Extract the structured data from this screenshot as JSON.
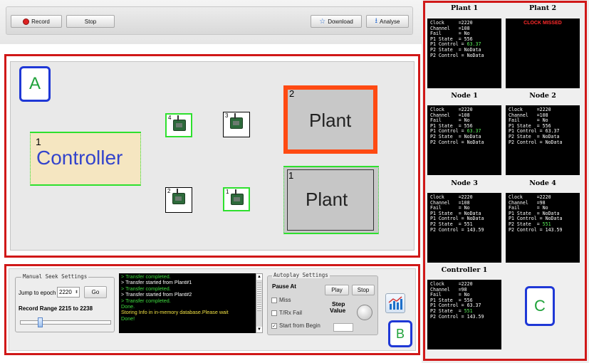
{
  "toolbar": {
    "record_label": "Record",
    "stop_label": "Stop",
    "download_label": "Download",
    "analyse_label": "Analyse"
  },
  "tags": {
    "a": "A",
    "b": "B",
    "c": "C"
  },
  "canvas": {
    "controller": {
      "id": "1",
      "label": "Controller"
    },
    "plant_top": {
      "id": "2",
      "label": "Plant"
    },
    "plant_bottom": {
      "id": "1",
      "label": "Plant"
    },
    "nodes": [
      {
        "id": "4"
      },
      {
        "id": "3"
      },
      {
        "id": "2"
      },
      {
        "id": "1"
      }
    ]
  },
  "seek": {
    "legend": "Manual Seek Settings",
    "jump_label": "Jump to epoch",
    "epoch_value": "2220",
    "go_label": "Go",
    "range_label": "Record Range 2215 to 2238"
  },
  "log": [
    {
      "text": "> Transfer completed.",
      "style": "g"
    },
    {
      "text": "> Transfer started from Plant#1",
      "style": ""
    },
    {
      "text": "> Transfer completed.",
      "style": "g"
    },
    {
      "text": "> Transfer started from Plant#2",
      "style": ""
    },
    {
      "text": "> Transfer completed.",
      "style": "g"
    },
    {
      "text": "Done.",
      "style": "g"
    },
    {
      "text": "Storing Info in in-memory database.Please wait",
      "style": "y"
    },
    {
      "text": "Done!",
      "style": "g"
    }
  ],
  "autoplay": {
    "legend": "Autoplay Settings",
    "pause_at": "Pause At",
    "play_label": "Play",
    "stop_label": "Stop",
    "miss_label": "Miss",
    "trx_label": "T/Rx Fail",
    "start_label": "Start from Begin",
    "step_value_label1": "Step",
    "step_value_label2": "Value"
  },
  "panels": {
    "plant1": {
      "title": "Plant 1"
    },
    "plant2": {
      "title": "Plant 2",
      "message": "CLOCK MISSED"
    },
    "node1": {
      "title": "Node 1"
    },
    "node2": {
      "title": "Node 2"
    },
    "node3": {
      "title": "Node 3"
    },
    "node4": {
      "title": "Node 4"
    },
    "controller1": {
      "title": "Controller 1"
    }
  },
  "terminals": {
    "plant1": [
      [
        "Clock     =2220",
        ""
      ],
      [
        "Channel   =108",
        ""
      ],
      [
        "Fail      = No",
        ""
      ],
      [
        "P1 State  = 556",
        ""
      ],
      [
        "P1 Control = ",
        "63.37"
      ],
      [
        "P2 State  = NoData",
        ""
      ],
      [
        "P2 Control = NoData",
        ""
      ]
    ],
    "node1": [
      [
        "Clock     =2220",
        ""
      ],
      [
        "Channel   =108",
        ""
      ],
      [
        "Fail      = No",
        ""
      ],
      [
        "P1 State  = 556",
        ""
      ],
      [
        "P1 Control = ",
        "63.37"
      ],
      [
        "P2 State  = NoData",
        ""
      ],
      [
        "P2 Control = NoData",
        ""
      ]
    ],
    "node2": [
      [
        "Clock     =2220",
        ""
      ],
      [
        "Channel   =108",
        ""
      ],
      [
        "Fail      = No",
        ""
      ],
      [
        "P1 State  = 556",
        ""
      ],
      [
        "P1 Control = 63.37",
        ""
      ],
      [
        "P2 State  = NoData",
        ""
      ],
      [
        "P2 Control = NoData",
        ""
      ]
    ],
    "node3": [
      [
        "Clock     =2220",
        ""
      ],
      [
        "Channel   =108",
        ""
      ],
      [
        "Fail      = No",
        ""
      ],
      [
        "P1 State  = NoData",
        ""
      ],
      [
        "P1 Control = NoData",
        ""
      ],
      [
        "P2 State  = 551",
        ""
      ],
      [
        "P2 Control = 143.59",
        ""
      ]
    ],
    "node4": [
      [
        "Clock     =2220",
        ""
      ],
      [
        "Channel   =98",
        ""
      ],
      [
        "Fail      = No",
        ""
      ],
      [
        "P1 State  = NoData",
        ""
      ],
      [
        "P1 Control = NoData",
        ""
      ],
      [
        "P2 State  = ",
        "551"
      ],
      [
        "P2 Control = 143.59",
        ""
      ]
    ],
    "controller1": [
      [
        "Clock     =2220",
        ""
      ],
      [
        "Channel   =98",
        ""
      ],
      [
        "Fail      = No",
        ""
      ],
      [
        "P1 State  = 556",
        ""
      ],
      [
        "P1 Control = 63.37",
        ""
      ],
      [
        "P2 State  = ",
        "551"
      ],
      [
        "P2 Control = 143.59",
        ""
      ]
    ]
  }
}
